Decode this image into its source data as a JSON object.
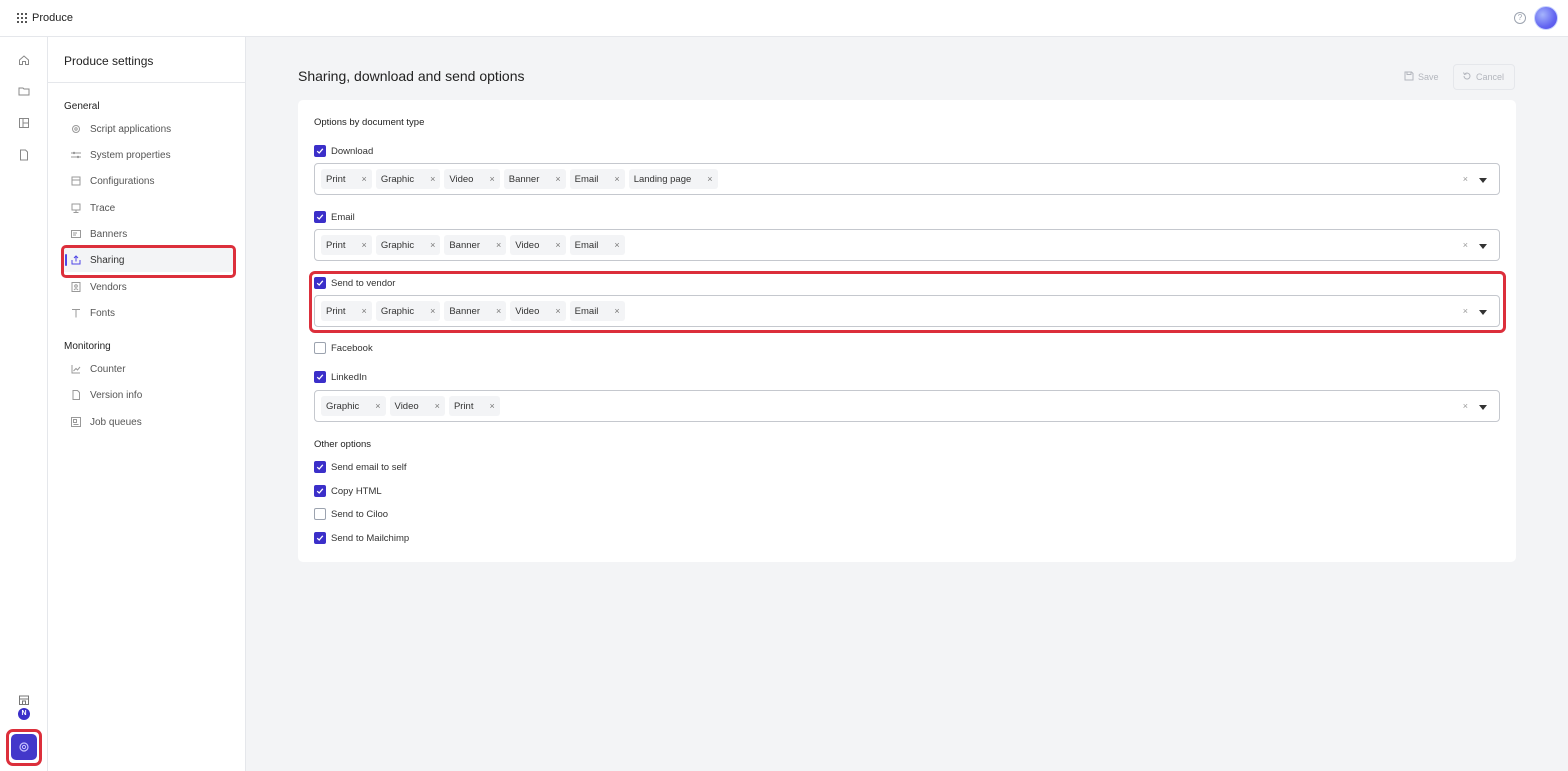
{
  "app": {
    "name": "Produce"
  },
  "sidebar": {
    "title": "Produce settings",
    "groups": [
      {
        "label": "General",
        "items": [
          {
            "label": "Script applications",
            "icon": "gear-icon"
          },
          {
            "label": "System properties",
            "icon": "sliders-icon"
          },
          {
            "label": "Configurations",
            "icon": "config-icon"
          },
          {
            "label": "Trace",
            "icon": "monitor-icon"
          },
          {
            "label": "Banners",
            "icon": "banner-icon"
          },
          {
            "label": "Sharing",
            "icon": "share-icon",
            "active": true
          },
          {
            "label": "Vendors",
            "icon": "vendor-icon"
          },
          {
            "label": "Fonts",
            "icon": "font-icon"
          }
        ]
      },
      {
        "label": "Monitoring",
        "items": [
          {
            "label": "Counter",
            "icon": "chart-icon"
          },
          {
            "label": "Version info",
            "icon": "document-icon"
          },
          {
            "label": "Job queues",
            "icon": "queue-icon"
          }
        ]
      }
    ]
  },
  "rail": {
    "badge": "N"
  },
  "main": {
    "title": "Sharing, download and send options",
    "save_label": "Save",
    "cancel_label": "Cancel",
    "options_label": "Options by document type",
    "doc_options": [
      {
        "label": "Download",
        "checked": true,
        "chips": [
          "Print",
          "Graphic",
          "Video",
          "Banner",
          "Email",
          "Landing page"
        ]
      },
      {
        "label": "Email",
        "checked": true,
        "chips": [
          "Print",
          "Graphic",
          "Banner",
          "Video",
          "Email"
        ]
      },
      {
        "label": "Send to vendor",
        "checked": true,
        "chips": [
          "Print",
          "Graphic",
          "Banner",
          "Video",
          "Email"
        ]
      },
      {
        "label": "Facebook",
        "checked": false,
        "chips": []
      },
      {
        "label": "LinkedIn",
        "checked": true,
        "chips": [
          "Graphic",
          "Video",
          "Print"
        ]
      }
    ],
    "other_label": "Other options",
    "other_options": [
      {
        "label": "Send email to self",
        "checked": true
      },
      {
        "label": "Copy HTML",
        "checked": true
      },
      {
        "label": "Send to Ciloo",
        "checked": false
      },
      {
        "label": "Send to Mailchimp",
        "checked": true
      }
    ]
  },
  "colors": {
    "accent": "#3b2fc9",
    "highlight": "#dc2f3b"
  }
}
